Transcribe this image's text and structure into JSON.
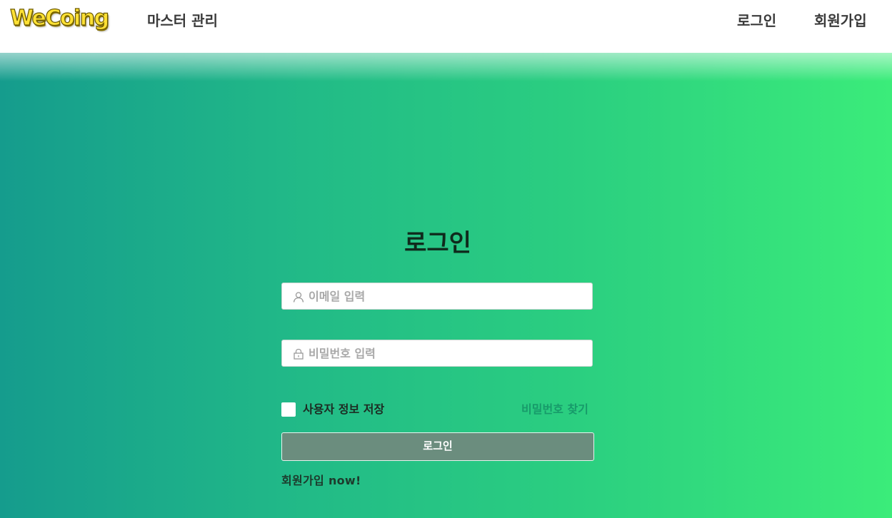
{
  "header": {
    "logo_text": "WeCoing",
    "nav_master": "마스터 관리",
    "nav_login": "로그인",
    "nav_signup": "회원가입"
  },
  "login": {
    "title": "로그인",
    "email_placeholder": "이메일 입력",
    "email_icon": "user-icon",
    "password_placeholder": "비밀번호 입력",
    "password_icon": "lock-icon",
    "remember_label": "사용자 정보 저장",
    "remember_checked": false,
    "find_password": "비밀번호 찾기",
    "button_label": "로그인",
    "signup_link": "회원가입 now!"
  },
  "colors": {
    "logo": "#ffe135",
    "gradient_start": "#159c8d",
    "gradient_end": "#3bec7a",
    "login_button": "#6b8d7e",
    "find_password_link": "#179a6a"
  }
}
